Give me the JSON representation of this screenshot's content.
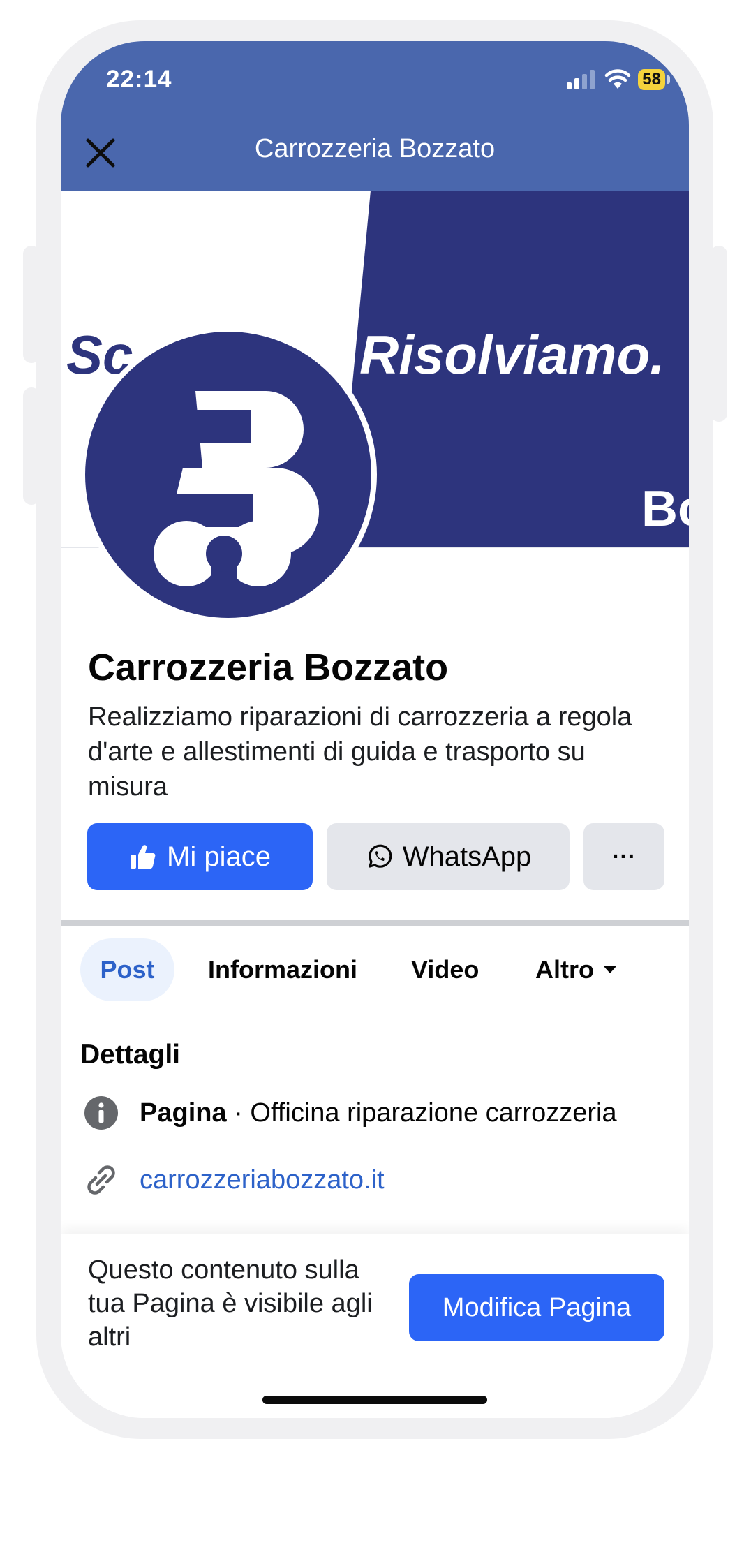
{
  "status_bar": {
    "time": "22:14",
    "battery_level": "58",
    "icons": [
      "cellular-signal-icon",
      "wifi-icon",
      "battery-icon"
    ]
  },
  "nav": {
    "title": "Carrozzeria Bozzato",
    "close_icon": "close-icon"
  },
  "cover": {
    "left_text": "Sc",
    "headline": "Risolviamo.",
    "corner_logo_text": "Bo",
    "colors": {
      "navy": "#2d347d",
      "white": "#ffffff"
    }
  },
  "profile": {
    "name": "Carrozzeria Bozzato",
    "description": "Realizziamo riparazioni di carrozzeria a regola d'arte e allestimenti di guida e trasporto su misura"
  },
  "actions": {
    "like_label": "Mi piace",
    "whatsapp_label": "WhatsApp",
    "more_label": "···"
  },
  "tabs": [
    {
      "label": "Post",
      "active": true
    },
    {
      "label": "Informazioni",
      "active": false
    },
    {
      "label": "Video",
      "active": false
    },
    {
      "label": "Altro",
      "active": false
    }
  ],
  "details": {
    "title": "Dettagli",
    "category_label": "Pagina",
    "category_separator": " · ",
    "category_value": "Officina riparazione carrozzeria",
    "website": "carrozzeriabozzato.it"
  },
  "bottom": {
    "notice": "Questo contenuto sulla tua Pagina è visibile agli altri",
    "edit_label": "Modifica Pagina"
  },
  "theme": {
    "header_blue": "#4a67ad",
    "primary_blue": "#2c65f6",
    "link_blue": "#2d62c9",
    "grey_button": "#e4e6eb"
  }
}
